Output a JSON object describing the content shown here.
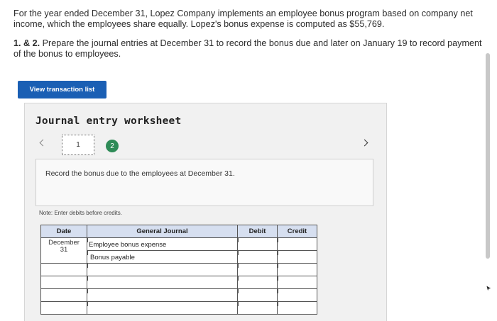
{
  "problem": {
    "paragraph1": "For the year ended December 31, Lopez Company implements an employee bonus program based on company net income, which the employees share equally. Lopez's bonus expense is computed as $55,769.",
    "paragraph2_bold": "1. & 2.",
    "paragraph2_rest": " Prepare the journal entries at December 31 to record the bonus due and later on January 19 to record payment of the bonus to employees."
  },
  "view_button": {
    "label": "View transaction list"
  },
  "worksheet": {
    "title": "Journal entry worksheet",
    "steps": [
      "1",
      "2"
    ],
    "active_step": "2",
    "instruction": "Record the bonus due to the employees at December 31.",
    "note": "Note: Enter debits before credits."
  },
  "table": {
    "headers": {
      "date": "Date",
      "general_journal": "General Journal",
      "debit": "Debit",
      "credit": "Credit"
    },
    "entry_date": {
      "month": "December",
      "day": "31"
    },
    "rows": [
      {
        "account": "Employee bonus expense",
        "debit": "",
        "credit": ""
      },
      {
        "account": "Bonus payable",
        "debit": "",
        "credit": ""
      },
      {
        "account": "",
        "debit": "",
        "credit": ""
      },
      {
        "account": "",
        "debit": "",
        "credit": ""
      },
      {
        "account": "",
        "debit": "",
        "credit": ""
      },
      {
        "account": "",
        "debit": "",
        "credit": ""
      }
    ]
  },
  "colors": {
    "button_blue": "#1a5fb4",
    "active_step_green": "#2e8b57",
    "table_header": "#d6dff0"
  },
  "icons": {
    "prev": "chevron-left-icon",
    "next": "chevron-right-icon",
    "cursor": "cursor-icon"
  }
}
